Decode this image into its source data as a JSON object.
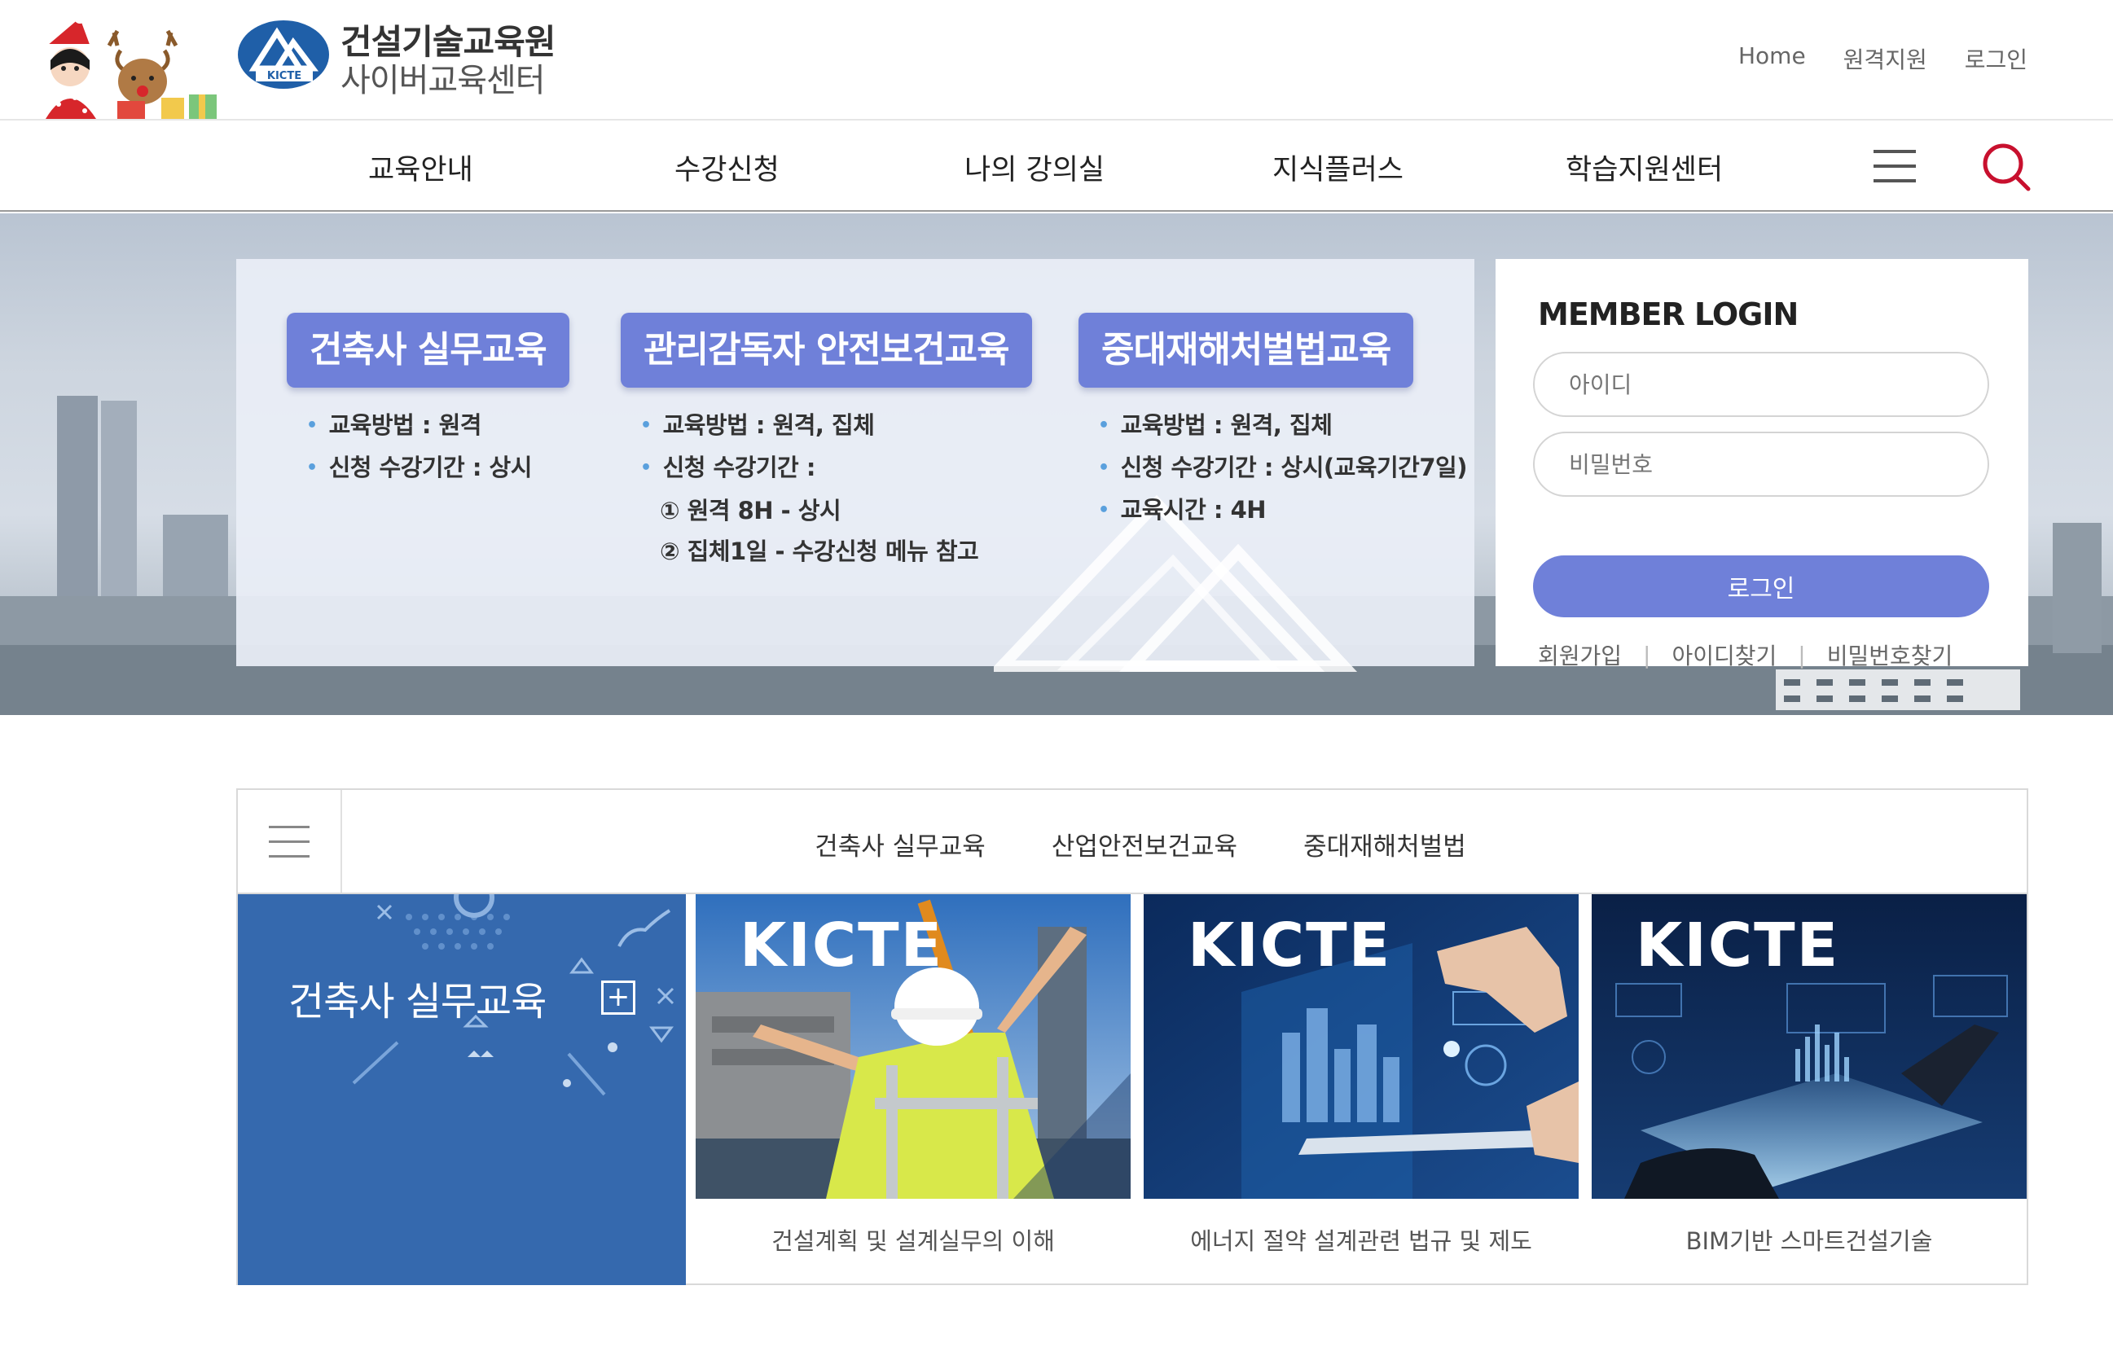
{
  "header": {
    "logo_title": "건설기술교육원",
    "logo_subtitle": "사이버교육센터",
    "emblem_text": "KICTE",
    "util_nav": [
      "Home",
      "원격지원",
      "로그인"
    ]
  },
  "gnb": {
    "items": [
      "교육안내",
      "수강신청",
      "나의 강의실",
      "지식플러스",
      "학습지원센터"
    ]
  },
  "hero": {
    "courses": [
      {
        "tag": "건축사 실무교육",
        "lines": [
          "교육방법 : 원격",
          "신청 수강기간 : 상시"
        ],
        "sub_lines": []
      },
      {
        "tag": "관리감독자 안전보건교육",
        "lines": [
          "교육방법 : 원격, 집체",
          "신청 수강기간 :"
        ],
        "sub_lines": [
          "① 원격 8H - 상시",
          "② 집체1일 - 수강신청 메뉴 참고"
        ]
      },
      {
        "tag": "중대재해처벌법교육",
        "lines": [
          "교육방법 : 원격, 집체",
          "신청 수강기간 : 상시(교육기간7일)",
          "교육시간 : 4H"
        ],
        "sub_lines": []
      }
    ]
  },
  "login": {
    "title": "MEMBER LOGIN",
    "id_placeholder": "아이디",
    "pw_placeholder": "비밀번호",
    "button": "로그인",
    "links": [
      "회원가입",
      "아이디찾기",
      "비밀번호찾기"
    ]
  },
  "section": {
    "tabs": [
      "건축사 실무교육",
      "산업안전보건교육",
      "중대재해처벌법"
    ],
    "feature_title": "건축사 실무교육",
    "cards": [
      {
        "brand": "KICTE",
        "caption": "건설계획 및 설계실무의 이해"
      },
      {
        "brand": "KICTE",
        "caption": "에너지 절약 설계관련 법규 및 제도"
      },
      {
        "brand": "KICTE",
        "caption": "BIM기반 스마트건설기술"
      }
    ]
  },
  "colors": {
    "accent": "#6f80d9",
    "feature_blue": "#3569ae",
    "search_red": "#c8102e"
  }
}
